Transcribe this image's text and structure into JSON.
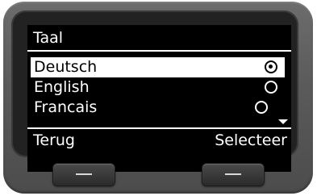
{
  "screen": {
    "title": "Taal",
    "options": [
      {
        "label": "Deutsch",
        "selected": true
      },
      {
        "label": "English",
        "selected": false
      },
      {
        "label": "Francais",
        "selected": false
      }
    ],
    "scroll_indicator": "arrow-down-icon"
  },
  "softkeys": {
    "left_label": "Terug",
    "right_label": "Selecteer"
  },
  "colors": {
    "screen_bg": "#000000",
    "screen_fg": "#ffffff",
    "device_body": "#5a5a5a"
  }
}
